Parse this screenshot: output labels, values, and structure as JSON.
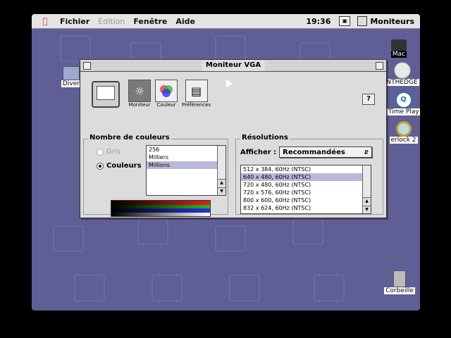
{
  "menubar": {
    "items": [
      "Fichier",
      "Édition",
      "Fenêtre",
      "Aide"
    ],
    "clock": "19:36",
    "app_name": "Moniteurs"
  },
  "desktop_icons": {
    "mac": "Mac",
    "cd": "NTHEDGE",
    "quicktime": "Time Play",
    "sherlock": "erlock 2",
    "folder": "Diver",
    "trash": "Corbeille"
  },
  "window": {
    "title": "Moniteur VGA",
    "help": "?",
    "toolbar": [
      {
        "label": "Moniteur",
        "icon": "sun-icon"
      },
      {
        "label": "Couleur",
        "icon": "color-wheel-icon"
      },
      {
        "label": "Préférences",
        "icon": "preferences-icon"
      }
    ]
  },
  "colors_group": {
    "title": "Nombre de couleurs",
    "radio_gray": "Gris",
    "radio_colors": "Couleurs",
    "options": [
      "256",
      "Milliers",
      "Millions"
    ],
    "selected": "Millions"
  },
  "resolutions_group": {
    "title": "Résolutions",
    "show_label": "Afficher :",
    "show_value": "Recommandées",
    "items": [
      "512 x 384, 60Hz (NTSC)",
      "640 x 480, 60Hz (NTSC)",
      "720 x 480, 60Hz (NTSC)",
      "720 x 576, 60Hz (NTSC)",
      "800 x 600, 60Hz (NTSC)",
      "832 x 624, 60Hz (NTSC)"
    ],
    "selected": "640 x 480, 60Hz (NTSC)"
  },
  "colors": {
    "desktop": "#5f5f95",
    "selection": "#b8b8d8"
  }
}
